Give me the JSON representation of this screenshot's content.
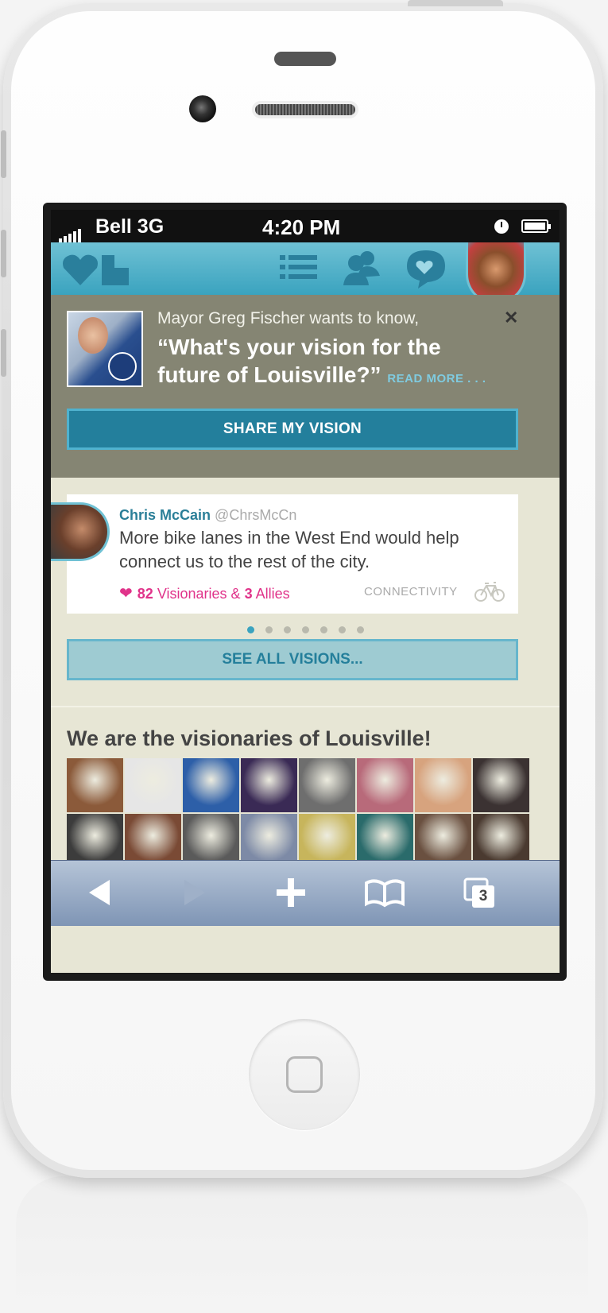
{
  "status_bar": {
    "carrier": "Bell 3G",
    "time": "4:20 PM"
  },
  "app_header": {
    "icons": [
      "logo-icon",
      "list-icon",
      "people-icon",
      "chat-heart-icon",
      "profile-avatar"
    ]
  },
  "question": {
    "intro": "Mayor Greg Fischer wants to know,",
    "main": "“What's your vision for the future of Louisville?”",
    "read_more": "READ MORE . . .",
    "close": "✕",
    "share_button": "SHARE MY VISION"
  },
  "vision_card": {
    "name": "Chris McCain",
    "handle": "@ChrsMcCn",
    "text": "More bike lanes in the West End would help connect us to the rest of the city.",
    "visionaries_count": "82",
    "visionaries_label": "Visionaries",
    "amp": "&",
    "allies_count": "3",
    "allies_label": "Allies",
    "category": "CONNECTIVITY"
  },
  "carousel": {
    "total": 7,
    "active_index": 0
  },
  "see_all_button": "SEE ALL VISIONS...",
  "visionaries": {
    "title": "We are the visionaries of Louisville!",
    "photos": [
      "#8b5a3a",
      "#e6e6e6",
      "#2d5fa8",
      "#3a2a55",
      "#6e6e6e",
      "#b86a7a",
      "#d7a37e",
      "#3b3232",
      "#3c3c3c",
      "#7a4a35",
      "#5a5a5a",
      "#7d8aa6",
      "#c7b55c",
      "#2a6b6b",
      "#6a5040",
      "#4a3a30"
    ]
  },
  "browser_toolbar": {
    "tabs_count": "3"
  },
  "colors": {
    "brand": "#3aa3bf",
    "share_button": "#237f9c",
    "pink": "#e0338a"
  }
}
